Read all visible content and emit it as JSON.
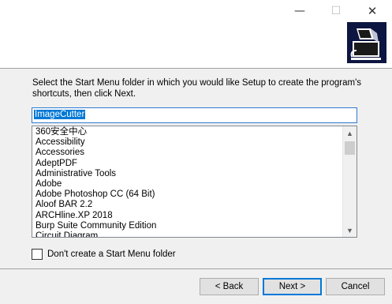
{
  "window": {
    "minimize_glyph": "—",
    "maximize_glyph": "☐",
    "close_glyph": "✕"
  },
  "instructions": "Select the Start Menu folder in which you would like Setup to create the program's shortcuts, then click Next.",
  "folder_input": {
    "value": "ImageCutter"
  },
  "folder_list": {
    "items": [
      "360安全中心",
      "Accessibility",
      "Accessories",
      "AdeptPDF",
      "Administrative Tools",
      "Adobe",
      "Adobe Photoshop CC (64 Bit)",
      "Aloof BAR 2.2",
      "ARCHline.XP 2018",
      "Burp Suite Community Edition",
      "Circuit Diagram"
    ],
    "scroll_up": "▲",
    "scroll_down": "▼"
  },
  "no_folder_checkbox": {
    "label": "Don't create a Start Menu folder",
    "checked": false
  },
  "buttons": {
    "back": "< Back",
    "next": "Next >",
    "cancel": "Cancel"
  },
  "colors": {
    "accent": "#0078d7",
    "logo_bg": "#0d1640"
  }
}
